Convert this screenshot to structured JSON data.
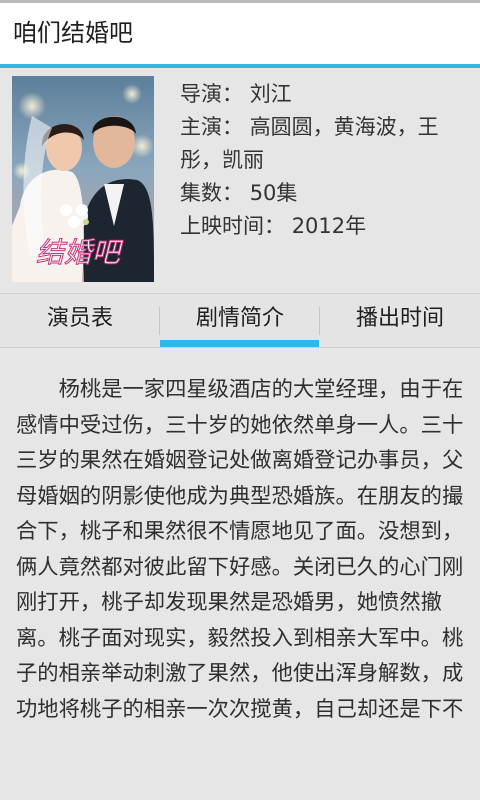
{
  "header": {
    "title": "咱们结婚吧"
  },
  "poster": {
    "title_art": "结婚吧"
  },
  "details": {
    "director_label": "导演：",
    "director": "刘江",
    "cast_label": "主演：",
    "cast": "高圆圆，黄海波，王彤，凯丽",
    "episodes_label": "集数：",
    "episodes": "50集",
    "release_label": "上映时间：",
    "release": "2012年"
  },
  "tabs": [
    {
      "label": "演员表",
      "selected": false
    },
    {
      "label": "剧情简介",
      "selected": true
    },
    {
      "label": "播出时间",
      "selected": false
    }
  ],
  "synopsis": {
    "text": "杨桃是一家四星级酒店的大堂经理，由于在感情中受过伤，三十岁的她依然单身一人。三十三岁的果然在婚姻登记处做离婚登记办事员，父母婚姻的阴影使他成为典型恐婚族。在朋友的撮合下，桃子和果然很不情愿地见了面。没想到，俩人竟然都对彼此留下好感。关闭已久的心门刚刚打开，桃子却发现果然是恐婚男，她愤然撤离。桃子面对现实，毅然投入到相亲大军中。桃子的相亲举动刺激了果然，他使出浑身解数，成功地将桃子的相亲一次次搅黄，自己却还是下不"
  },
  "colors": {
    "accent": "#33b5e5",
    "background": "#e6e6e6",
    "title_bar": "#ffffff"
  }
}
